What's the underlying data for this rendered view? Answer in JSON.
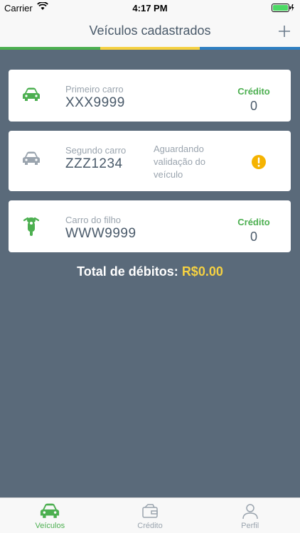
{
  "status_bar": {
    "carrier": "Carrier",
    "time": "4:17 PM"
  },
  "header": {
    "title": "Veículos cadastrados"
  },
  "colors": {
    "accent_green": "#4caf50",
    "accent_yellow": "#f5d142",
    "accent_blue": "#2f7fc1",
    "background": "#5a6a7a",
    "warning": "#f5b301",
    "inactive_gray": "#9aa4ae"
  },
  "vehicles": [
    {
      "name": "Primeiro carro",
      "plate": "XXX9999",
      "credit_label": "Crédito",
      "credit_value": "0",
      "icon": "car-icon"
    },
    {
      "name": "Segundo carro",
      "plate": "ZZZ1234",
      "status": "Aguardando validação do veículo",
      "icon": "car-icon"
    },
    {
      "name": "Carro do filho",
      "plate": "WWW9999",
      "credit_label": "Crédito",
      "credit_value": "0",
      "icon": "motorcycle-icon"
    }
  ],
  "summary": {
    "total_label": "Total de débitos:",
    "total_value": "R$0.00"
  },
  "tabs": [
    {
      "label": "Veículos",
      "icon": "car-icon",
      "active": true
    },
    {
      "label": "Crédito",
      "icon": "wallet-icon",
      "active": false
    },
    {
      "label": "Perfil",
      "icon": "user-icon",
      "active": false
    }
  ]
}
